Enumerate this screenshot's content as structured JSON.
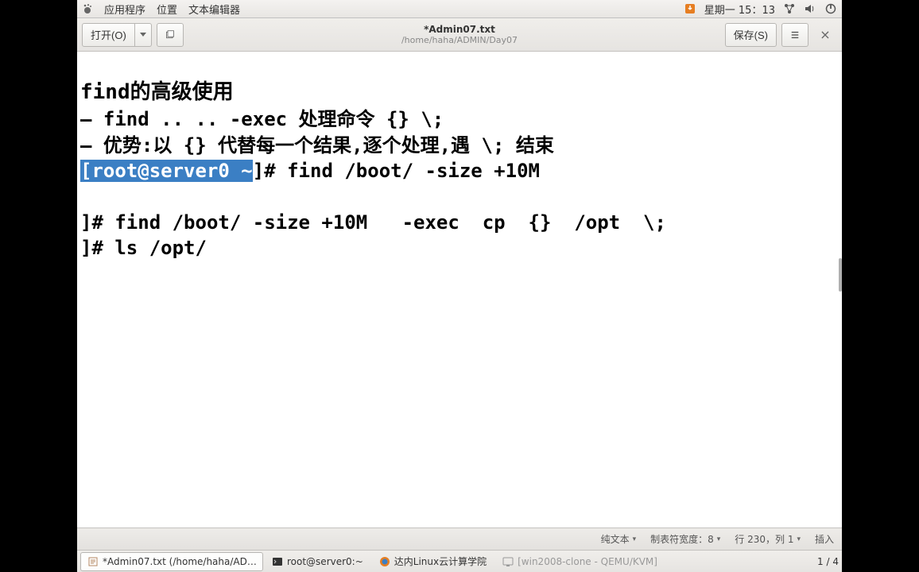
{
  "menubar": {
    "applications": "应用程序",
    "locations": "位置",
    "texteditor": "文本编辑器",
    "clock": "星期一 15：13"
  },
  "window": {
    "open": "打开(O)",
    "save": "保存(S)",
    "title": "*Admin07.txt",
    "subtitle": "/home/haha/ADMIN/Day07"
  },
  "editor": {
    "l1": "find的高级使用",
    "l2": "– find .. .. -exec 处理命令 {} \\;",
    "l3": "– 优势:以 {} 代替每一个结果,逐个处理,遇 \\; 结束",
    "l4_hl": "[root@server0 ~",
    "l4_rest": "]# find /boot/ -size +10M",
    "l5": "",
    "l6": "]# find /boot/ -size +10M   -exec  cp  {}  /opt  \\;",
    "l7": "]# ls /opt/"
  },
  "status": {
    "syntax": "纯文本",
    "tabwidth": "制表符宽度：8",
    "position": "行 230，列 1",
    "mode": "插入"
  },
  "taskbar": {
    "t1": "*Admin07.txt (/home/haha/AD…",
    "t2": "root@server0:~",
    "t3": "达内Linux云计算学院",
    "t4": "[win2008-clone - QEMU/KVM]",
    "pager": "1 / 4"
  }
}
